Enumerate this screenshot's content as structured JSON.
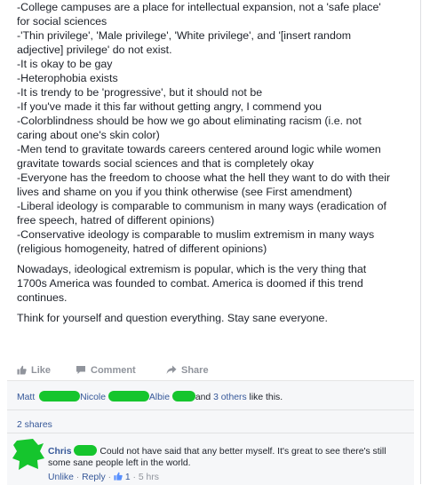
{
  "post": {
    "lines": [
      "-College campuses are a place for intellectual expansion, not a 'safe place'",
      "for social sciences",
      "-'Thin privilege', 'Male privilege', 'White privilege', and '[insert random",
      "adjective] privilege' do not exist.",
      "-It is okay to be gay",
      "-Heterophobia exists",
      "-It is trendy to be 'progressive', but it should not be",
      "-If you've made it this far without getting angry, I commend you",
      "-Colorblindness should be how we go about eliminating racism (i.e. not",
      "caring about one's skin color)",
      "-Men tend to gravitate towards careers centered around logic while women",
      "gravitate towards social sciences and that is completely okay",
      "-Everyone has the freedom to choose what the hell they want to do with their",
      "lives and shame on you if you think otherwise (see First amendment)",
      "-Liberal ideology is comparable to communism in many ways (eradication of",
      "free speech, hatred of different opinions)",
      "-Conservative ideology is comparable to muslim extremism in many ways",
      "(religious homogeneity, hatred of different opinions)"
    ],
    "para1": [
      "Nowadays, ideological extremism is popular, which is the very thing that",
      "1700s America was founded to combat. America is doomed if this trend",
      "continues."
    ],
    "para2": "Think for yourself and question everything. Stay sane everyone."
  },
  "actions": {
    "like": "Like",
    "comment": "Comment",
    "share": "Share"
  },
  "likes_summary": {
    "name1": "Matt",
    "name2": "Nicole",
    "name3": "Albie",
    "and_text": "and",
    "others": "3 others",
    "tail": "like this."
  },
  "shares": "2 shares",
  "comment": {
    "author": "Chris",
    "text_line1": "Could not have said that any better myself. It's great to see there's still",
    "text_line2": "some sane people left in the world.",
    "unlike": "Unlike",
    "dot": "·",
    "reply": "Reply",
    "like_count": "1",
    "time": "5 hrs"
  },
  "colors": {
    "link": "#365899",
    "text": "#1d2129",
    "muted": "#90949c",
    "redaction": "#15c52d"
  },
  "icons": {
    "like": "thumbs-up-icon",
    "comment": "speech-bubble-icon",
    "share": "share-arrow-icon"
  }
}
